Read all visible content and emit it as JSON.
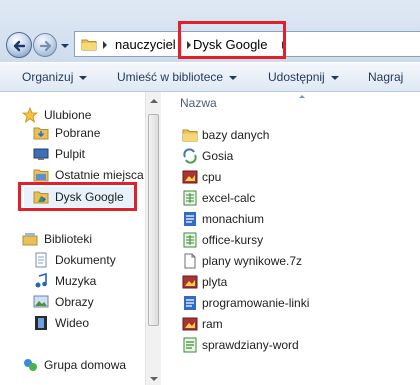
{
  "address": {
    "crumbs": [
      "nauczyciel",
      "Dysk Google"
    ]
  },
  "toolbar": {
    "organize": "Organizuj",
    "include_in_library": "Umieść w bibliotece",
    "share": "Udostępnij",
    "burn": "Nagraj"
  },
  "nav": {
    "favorites": "Ulubione",
    "downloads": "Pobrane",
    "desktop": "Pulpit",
    "recent": "Ostatnie miejsca",
    "google_drive": "Dysk Google",
    "libraries": "Biblioteki",
    "documents": "Dokumenty",
    "music": "Muzyka",
    "pictures": "Obrazy",
    "videos": "Wideo",
    "homegroup": "Grupa domowa"
  },
  "files": {
    "column_name": "Nazwa",
    "items": [
      {
        "name": "bazy danych",
        "icon": "folder-icon"
      },
      {
        "name": "Gosia",
        "icon": "shared-folder-icon"
      },
      {
        "name": "cpu",
        "icon": "image-file-icon"
      },
      {
        "name": "excel-calc",
        "icon": "spreadsheet-file-icon"
      },
      {
        "name": "monachium",
        "icon": "document-file-icon"
      },
      {
        "name": "office-kursy",
        "icon": "spreadsheet-file-icon"
      },
      {
        "name": "plany wynikowe.7z",
        "icon": "archive-file-icon"
      },
      {
        "name": "plyta",
        "icon": "image-file-icon"
      },
      {
        "name": "programowanie-linki",
        "icon": "document-file-icon"
      },
      {
        "name": "ram",
        "icon": "image-file-icon"
      },
      {
        "name": "sprawdziany-word",
        "icon": "document-file-icon"
      }
    ]
  },
  "colors": {
    "highlight": "#e0212b",
    "selection": "#e8f2fd",
    "toolbar_text": "#1e395b"
  }
}
